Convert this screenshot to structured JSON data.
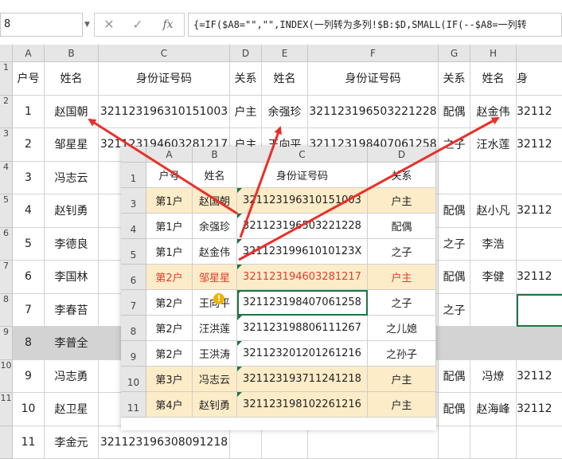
{
  "formula_bar": {
    "name_box": "8",
    "name_box_arrow": "▼",
    "cancel_glyph": "✕",
    "enter_glyph": "✓",
    "fx_glyph": "fx",
    "formula": "{=IF($A8=\"\",\"\",INDEX(一列转为多列!$B:$D,SMALL(IF(--$A8=一列转"
  },
  "sheet": {
    "col_headers": [
      "A",
      "B",
      "C",
      "D",
      "E",
      "F",
      "G",
      "H"
    ],
    "row_headers": [
      "1",
      "2",
      "3",
      "4",
      "5",
      "6",
      "7",
      "8",
      "9",
      "10",
      "11"
    ],
    "rows": [
      [
        "户号",
        "姓名",
        "身份证号码",
        "关系",
        "姓名",
        "身份证号码",
        "关系",
        "姓名",
        "身"
      ],
      [
        "1",
        "赵国朝",
        "321123196310151003",
        "户主",
        "余强珍",
        "321123196503221228",
        "配偶",
        "赵金伟",
        "32112"
      ],
      [
        "2",
        "邹星星",
        "321123194603281217",
        "户主",
        "王向平",
        "321123198407061258",
        "之子",
        "汪水莲",
        "32112"
      ],
      [
        "3",
        "冯志云",
        "",
        "",
        "",
        "",
        "",
        "",
        ""
      ],
      [
        "4",
        "赵钊勇",
        "32",
        "",
        "",
        "",
        "配偶",
        "赵小凡",
        "32112"
      ],
      [
        "5",
        "李德良",
        "32",
        "",
        "",
        "",
        "之子",
        "李浩",
        ""
      ],
      [
        "6",
        "李国林",
        "32",
        "",
        "",
        "",
        "配偶",
        "李健",
        "32112"
      ],
      [
        "7",
        "李春苔",
        "",
        "",
        "",
        "",
        "之子",
        "",
        ""
      ],
      [
        "8",
        "李普全",
        "",
        "",
        "",
        "",
        "",
        "",
        ""
      ],
      [
        "9",
        "冯志勇",
        "32",
        "",
        "",
        "",
        "配偶",
        "冯燎",
        "32112"
      ],
      [
        "10",
        "赵卫星",
        "32",
        "",
        "",
        "",
        "配偶",
        "赵海峰",
        "32112"
      ],
      [
        "11",
        "李金元",
        "321123196308091218",
        "",
        "",
        "",
        "",
        "",
        ""
      ]
    ]
  },
  "popup": {
    "col_headers": [
      "A",
      "B",
      "C",
      "D"
    ],
    "row_headers": [
      "1",
      "3",
      "4",
      "5",
      "6",
      "7",
      "8",
      "9",
      "10",
      "11"
    ],
    "rows": [
      [
        "户号",
        "姓名",
        "身份证号码",
        "关系"
      ],
      [
        "第1户",
        "赵国朝",
        "321123196310151003",
        "户主"
      ],
      [
        "第1户",
        "余强珍",
        "321123196503221228",
        "配偶"
      ],
      [
        "第1户",
        "赵金伟",
        "32112319961010123X",
        "之子"
      ],
      [
        "第2户",
        "邹星星",
        "321123194603281217",
        "户主"
      ],
      [
        "第2户",
        "王向平",
        "321123198407061258",
        "之子"
      ],
      [
        "第2户",
        "汪洪莲",
        "321123198806111267",
        "之儿媳"
      ],
      [
        "第2户",
        "王洪涛",
        "321123201201261216",
        "之孙子"
      ],
      [
        "第3户",
        "冯志云",
        "321123193711241218",
        "户主"
      ],
      [
        "第4户",
        "赵钊勇",
        "321123198102261216",
        "户主"
      ]
    ],
    "warning_glyph": "!"
  },
  "colors": {
    "highlight_fill": "#fdecc8",
    "red_text": "#e03c31",
    "arrow": "#e8302a",
    "excel_green": "#217346"
  }
}
